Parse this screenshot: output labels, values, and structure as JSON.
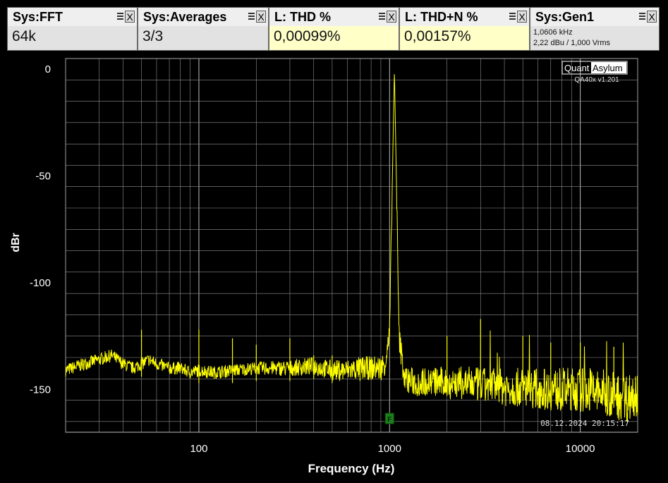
{
  "widgets": [
    {
      "title": "Sys:FFT",
      "value": "64k"
    },
    {
      "title": "Sys:Averages",
      "value": "3/3"
    },
    {
      "title": "L: THD %",
      "value": "0,00099%"
    },
    {
      "title": "L: THD+N %",
      "value": "0,00157%"
    },
    {
      "title": "Sys:Gen1",
      "line1": "1,0606 kHz",
      "line2": "2,22 dBu  / 1,000 Vrms"
    }
  ],
  "widget_close_glyph": "X",
  "branding": {
    "logo_left": "Quant",
    "logo_right": "Asylum",
    "version": "QA40x v1.201"
  },
  "timestamp": "08.12.2024 20:15:17",
  "marker_label": "F",
  "colors": {
    "trace": "#ffff00",
    "background": "#000000",
    "grid": "#bdbdbd",
    "widget_highlight": "#ffffc8",
    "marker": "#1c7f1c"
  },
  "chart_data": {
    "type": "line",
    "x_scale": "log",
    "xlabel": "Frequency (Hz)",
    "ylabel": "dBr",
    "xlim": [
      20,
      20000
    ],
    "ylim": [
      -170,
      5
    ],
    "x_ticks": [
      100,
      1000,
      10000
    ],
    "x_tick_labels": [
      "100",
      "1000",
      "10000"
    ],
    "y_ticks": [
      0,
      -50,
      -100,
      -150
    ],
    "y_tick_labels": [
      "0",
      "-50",
      "-100",
      "-150"
    ],
    "grid": true,
    "legend": "none",
    "series": [
      {
        "x": [
          20,
          25,
          30,
          35,
          40,
          45,
          50,
          55,
          60,
          70,
          80,
          90,
          100,
          120,
          150,
          200,
          250,
          300,
          400,
          500,
          600,
          700,
          800,
          900,
          950,
          1000,
          1030,
          1060,
          1090,
          1120,
          1200,
          1400,
          1600,
          2000,
          2500,
          3000,
          4000,
          5000,
          7000,
          10000,
          12000,
          14000,
          16000,
          18000,
          20000
        ],
        "y": [
          -141,
          -138,
          -136,
          -134,
          -138,
          -140,
          -138,
          -136,
          -138,
          -140,
          -140,
          -142,
          -141,
          -142,
          -141,
          -140,
          -140,
          -140,
          -139,
          -141,
          -141,
          -140,
          -140,
          -140,
          -137,
          -125,
          -60,
          0,
          -60,
          -125,
          -145,
          -147,
          -146,
          -147,
          -147,
          -148,
          -149,
          -149,
          -150,
          -150,
          -151,
          -152,
          -153,
          -154,
          -150
        ]
      }
    ],
    "peaks": [
      {
        "x": 50,
        "y": -122
      },
      {
        "x": 100,
        "y": -122
      },
      {
        "x": 150,
        "y": -126
      },
      {
        "x": 200,
        "y": -129
      },
      {
        "x": 300,
        "y": -126
      },
      {
        "x": 400,
        "y": -134
      },
      {
        "x": 500,
        "y": -134
      },
      {
        "x": 700,
        "y": -136
      },
      {
        "x": 2000,
        "y": -125
      },
      {
        "x": 3000,
        "y": -117
      },
      {
        "x": 5000,
        "y": -125
      },
      {
        "x": 7000,
        "y": -128
      },
      {
        "x": 10000,
        "y": -128
      },
      {
        "x": 15000,
        "y": -130
      }
    ],
    "marker": {
      "x": 1000,
      "label": "F"
    }
  }
}
